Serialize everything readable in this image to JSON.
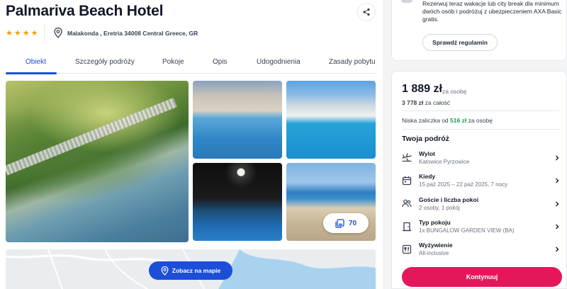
{
  "hotel": {
    "name": "Palmariva Beach Hotel",
    "stars": 4,
    "address": "Malakonda , Eretria 34008 Central Greece, GR"
  },
  "tabs": [
    {
      "label": "Obiekt",
      "active": true
    },
    {
      "label": "Szczegóły podróży",
      "active": false
    },
    {
      "label": "Pokoje",
      "active": false
    },
    {
      "label": "Opis",
      "active": false
    },
    {
      "label": "Udogodnienia",
      "active": false
    },
    {
      "label": "Zasady pobytu",
      "active": false
    }
  ],
  "gallery": {
    "photo_count": "70"
  },
  "map": {
    "button_label": "Zobacz na mapie"
  },
  "promo": {
    "text": "Rezerwuj teraz wakacje lub city break dla minimum dwóch osób i podróżuj z ubezpieczeniem AXA Basic gratis.",
    "button_label": "Sprawdź regulamin"
  },
  "booking": {
    "price": "1 889 zł",
    "price_unit": "za osobę",
    "total_value": "3 778 zł",
    "total_unit": "za całość",
    "deposit_prefix": "Niska zaliczka od",
    "deposit_amount": "516 zł",
    "deposit_suffix": "za osobę",
    "trip_title": "Twoja podróż",
    "rows": [
      {
        "icon": "plane-icon",
        "label": "Wylot",
        "value": "Katowice Pyrzowice"
      },
      {
        "icon": "calendar-icon",
        "label": "Kiedy",
        "value": "15 paź 2025 – 22 paź 2025, 7 nocy"
      },
      {
        "icon": "guests-icon",
        "label": "Goście i liczba pokoi",
        "value": "2 osoby, 1 pokój"
      },
      {
        "icon": "door-icon",
        "label": "Typ pokoju",
        "value": "1x BUNGALOW GARDEN VIEW (BA)"
      },
      {
        "icon": "meal-icon",
        "label": "Wyżywienie",
        "value": "All-inclusive"
      }
    ],
    "continue_label": "Kontynuuj"
  },
  "colors": {
    "accent_blue": "#1d4ed8",
    "primary_pink": "#e5175b",
    "deposit_green": "#16a34a",
    "star": "#f59e0b"
  }
}
